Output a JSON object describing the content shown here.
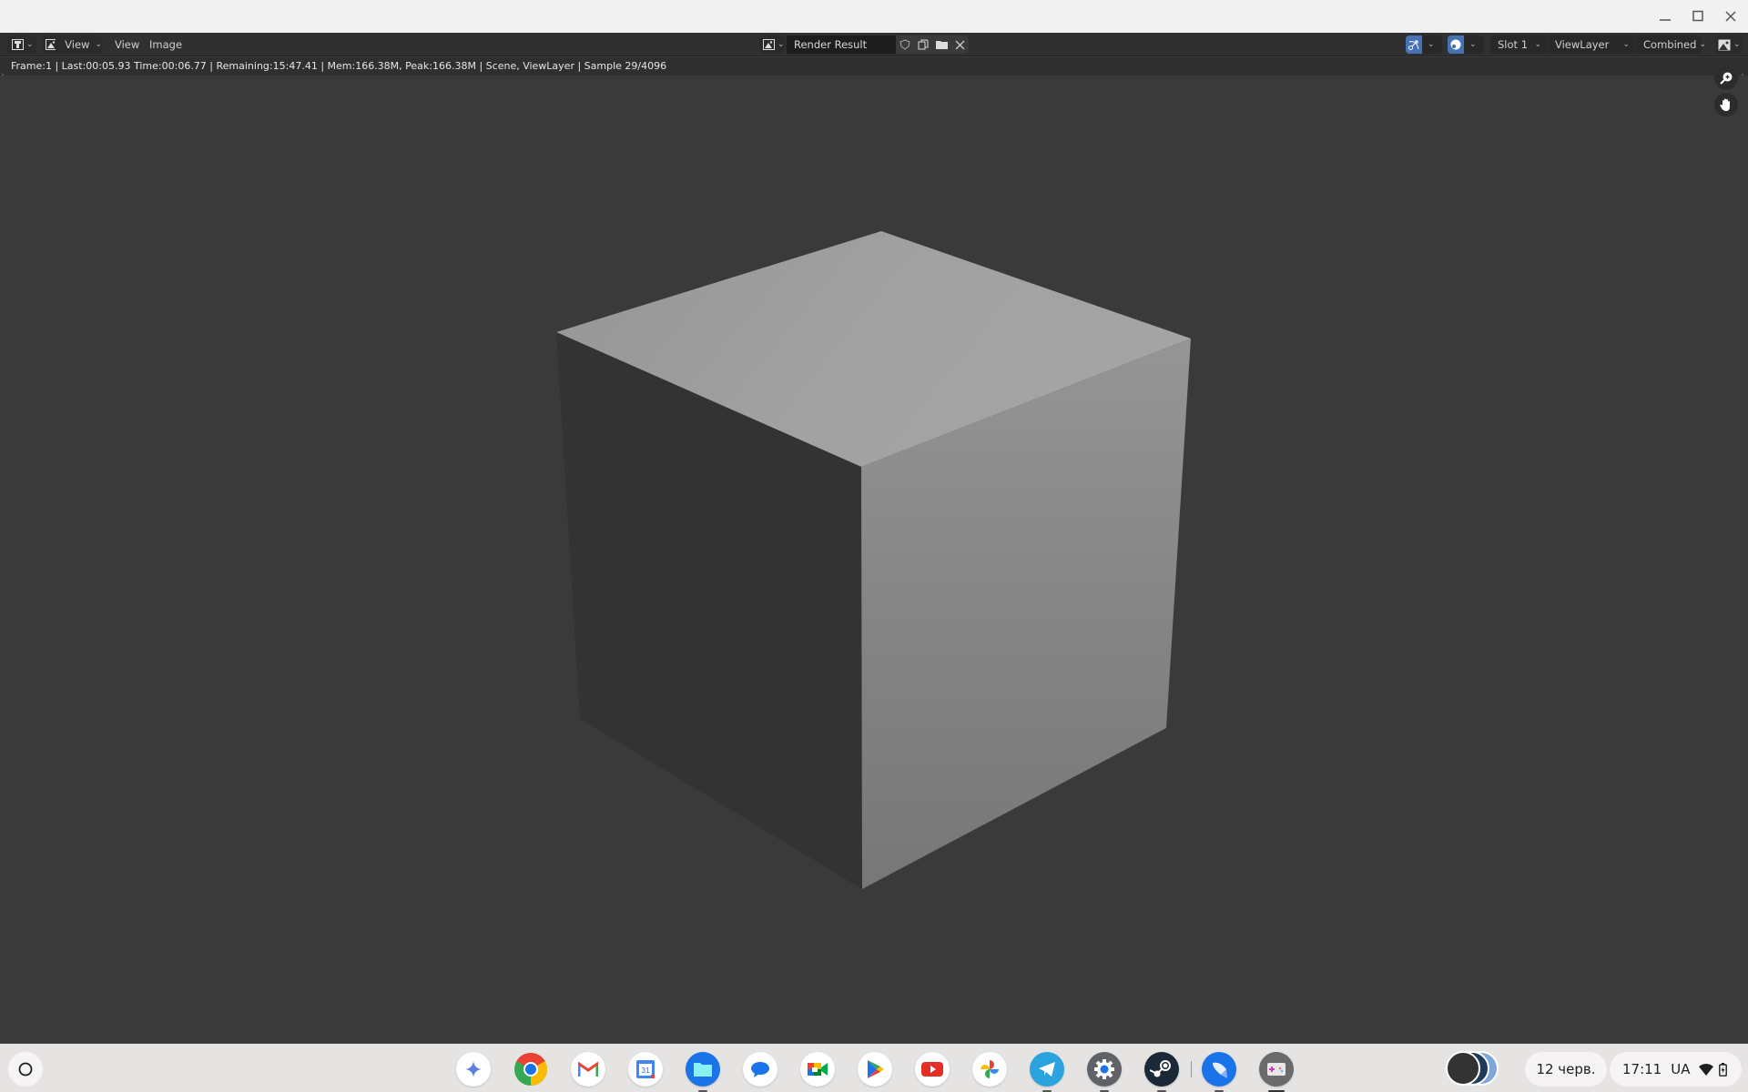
{
  "window": {
    "controls": {
      "minimize_icon": "minimize-icon",
      "maximize_icon": "maximize-icon",
      "close_icon": "close-icon"
    }
  },
  "header": {
    "editor_type_icon": "image-editor-icon",
    "mode_icon": "image-mode-icon",
    "view_dropdown_label": "View",
    "menus": [
      "View",
      "Image"
    ],
    "image_name": "Render Result",
    "image_actions": [
      "fake-user-shield-icon",
      "duplicate-image-icon",
      "open-image-folder-icon",
      "unlink-image-close-icon"
    ],
    "toggles": [
      {
        "icon": "uv-sculpt-icon",
        "active": true
      },
      {
        "icon": "overlay-icon",
        "active": true
      }
    ],
    "slot": "Slot 1",
    "view_layer": "ViewLayer",
    "pass": "Combined",
    "display_channels_icon": "display-channels-icon",
    "accent_color": "#4772b3"
  },
  "status": {
    "text": "Frame:1 | Last:00:05.93 Time:00:06.77 | Remaining:15:47.41 | Mem:166.38M, Peak:166.38M | Scene, ViewLayer | Sample 29/4096",
    "frame": "1",
    "last": "00:05.93",
    "time": "00:06.77",
    "remaining": "15:47.41",
    "mem": "166.38M",
    "peak": "166.38M",
    "scene": "Scene",
    "view_layer": "ViewLayer",
    "sample": "29/4096"
  },
  "viewport": {
    "background": "#3a3a3a",
    "gizmos": [
      "zoom-icon",
      "pan-hand-icon"
    ],
    "render": {
      "subject": "default cube",
      "colors": {
        "top": "#9c9c9c",
        "left": "#333333",
        "right": "#878787"
      }
    }
  },
  "shelf": {
    "launcher_icon": "launcher-icon",
    "apps": [
      {
        "name": "Gemini",
        "icon": "gemini-icon"
      },
      {
        "name": "Chrome",
        "icon": "chrome-icon"
      },
      {
        "name": "Gmail",
        "icon": "gmail-icon"
      },
      {
        "name": "Calendar",
        "icon": "calendar-icon",
        "label": "31"
      },
      {
        "name": "Files",
        "icon": "files-icon",
        "running": true
      },
      {
        "name": "Messages",
        "icon": "messages-icon"
      },
      {
        "name": "Meet",
        "icon": "meet-icon"
      },
      {
        "name": "Play Store",
        "icon": "play-store-icon"
      },
      {
        "name": "YouTube",
        "icon": "youtube-icon"
      },
      {
        "name": "Photos",
        "icon": "photos-icon"
      },
      {
        "name": "Telegram",
        "icon": "telegram-icon",
        "running": true
      },
      {
        "name": "Settings",
        "icon": "settings-icon",
        "running": true
      },
      {
        "name": "Steam",
        "icon": "steam-icon",
        "running": true
      },
      {
        "name": "Rocket",
        "icon": "rocket-icon",
        "running": true
      },
      {
        "name": "Game",
        "icon": "game-icon",
        "running": true
      }
    ],
    "date": "12 черв.",
    "time": "17:11",
    "input_lang": "UA",
    "wifi_icon": "wifi-icon",
    "battery_icon": "battery-charging-icon"
  }
}
